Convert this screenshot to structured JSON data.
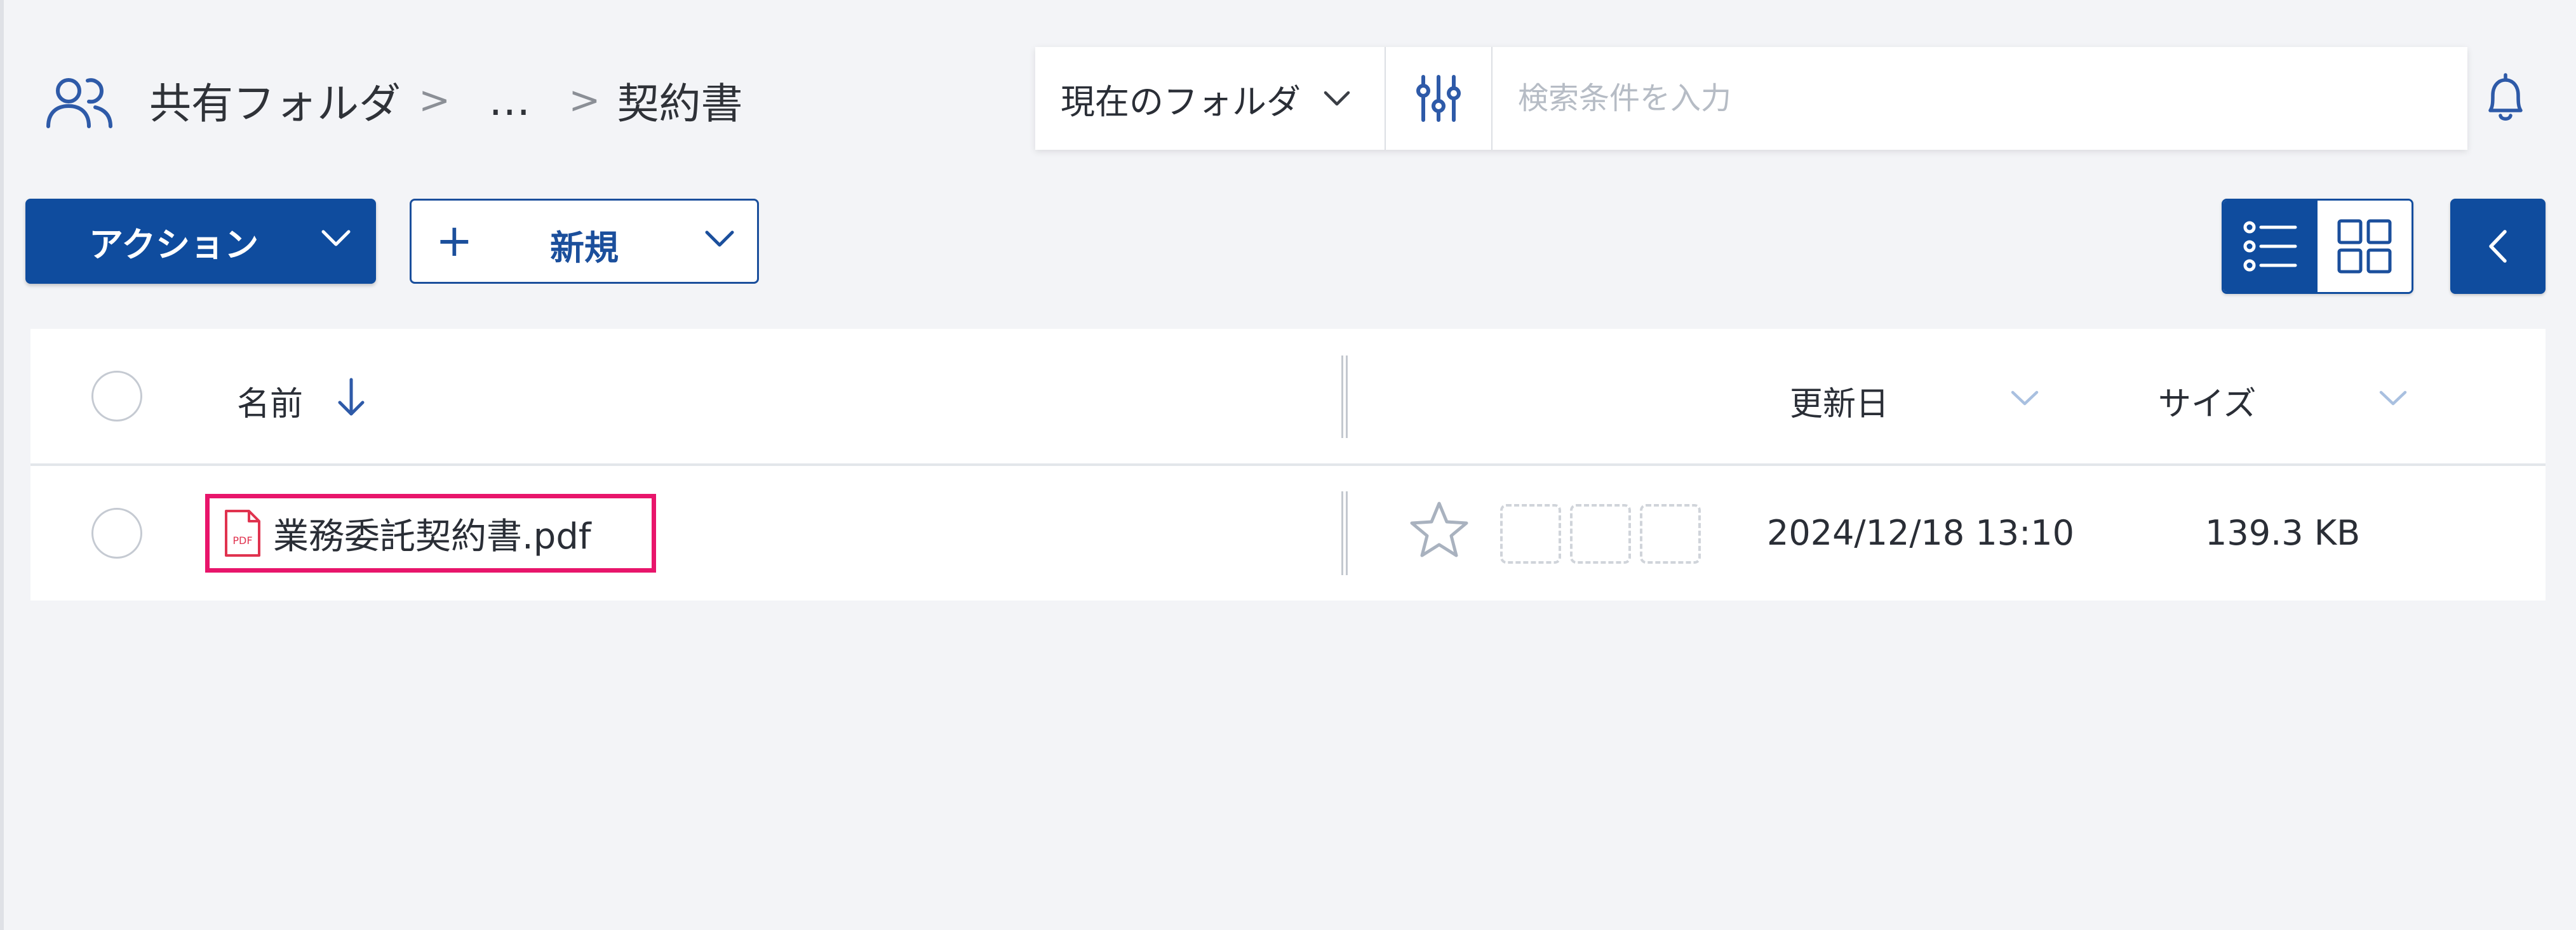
{
  "breadcrumb": {
    "root": "共有フォルダ",
    "sep1": ">",
    "ellipsis": "…",
    "sep2": ">",
    "current": "契約書"
  },
  "search": {
    "scope": "現在のフォルダ",
    "placeholder": "検索条件を入力"
  },
  "toolbar": {
    "action_label": "アクション",
    "new_plus": "+",
    "new_label": "新規"
  },
  "view_mode": "list",
  "table": {
    "columns": {
      "name": "名前",
      "updated": "更新日",
      "size": "サイズ"
    },
    "sort": {
      "column": "name",
      "direction": "descending"
    },
    "rows": [
      {
        "file_name": "業務委託契約書.pdf",
        "file_type_icon": "pdf-icon",
        "favorite": false,
        "updated": "2024/12/18 13:10",
        "size": "139.3 KB",
        "highlighted": true
      }
    ]
  },
  "colors": {
    "primary": "#0f4c9e",
    "highlight": "#e8156b",
    "pdf": "#e0334f"
  },
  "icons": [
    "people-icon",
    "chevron-down-icon",
    "filter-sliders-icon",
    "bell-icon",
    "list-view-icon",
    "grid-view-icon",
    "chevron-left-icon",
    "sort-arrow-down-icon",
    "pdf-icon",
    "star-icon"
  ]
}
